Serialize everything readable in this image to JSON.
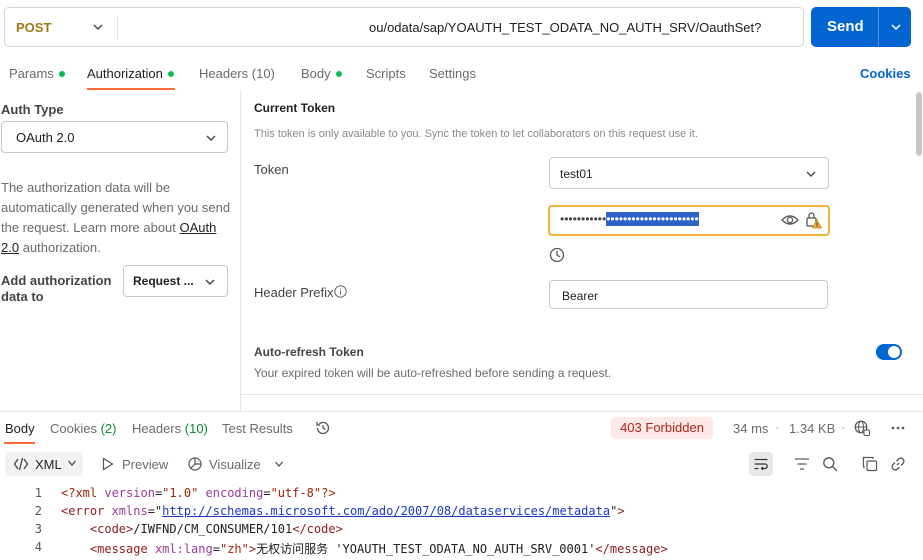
{
  "request": {
    "method": "POST",
    "url": "ou/odata/sap/YOAUTH_TEST_ODATA_NO_AUTH_SRV/OauthSet?",
    "send_label": "Send"
  },
  "tabs": [
    {
      "label": "Params",
      "dot": true
    },
    {
      "label": "Authorization",
      "dot": true
    },
    {
      "label": "Headers",
      "count": "(10)"
    },
    {
      "label": "Body",
      "dot": true
    },
    {
      "label": "Scripts"
    },
    {
      "label": "Settings"
    }
  ],
  "cookies_label": "Cookies",
  "auth": {
    "type_label": "Auth Type",
    "type_value": "OAuth 2.0",
    "desc_prefix": "The authorization data will be automatically generated when you send the request. Learn more about ",
    "desc_link": "OAuth 2.0",
    "desc_suffix": " authorization.",
    "add_to_label": "Add authorization data to",
    "add_to_value": "Request ..."
  },
  "current_token": {
    "title": "Current Token",
    "description": "This token is only available to you. Sync the token to let collaborators on this request use it.",
    "token_label": "Token",
    "token_select": "test01",
    "token_masked_plain": "•••••••••••",
    "token_masked_selected": "••••••••••••••••••••••",
    "header_prefix_label": "Header Prefix",
    "header_prefix_value": "Bearer",
    "autorefresh_label": "Auto-refresh Token",
    "autorefresh_desc": "Your expired token will be auto-refreshed before sending a request.",
    "autorefresh_on": true
  },
  "response": {
    "tabs": [
      {
        "label": "Body"
      },
      {
        "label": "Cookies",
        "count": "(2)"
      },
      {
        "label": "Headers",
        "count": "(10)"
      },
      {
        "label": "Test Results"
      }
    ],
    "status": "403 Forbidden",
    "time": "34 ms",
    "size": "1.34 KB",
    "format": "XML",
    "preview_label": "Preview",
    "visualize_label": "Visualize",
    "lines": [
      {
        "n": "1",
        "parts": [
          [
            "pi",
            "<?xml "
          ],
          [
            "attr",
            "version"
          ],
          [
            "txt",
            "="
          ],
          [
            "val",
            "\"1.0\""
          ],
          [
            "txt",
            " "
          ],
          [
            "attr",
            "encoding"
          ],
          [
            "txt",
            "="
          ],
          [
            "val",
            "\"utf-8\""
          ],
          [
            "pi",
            "?>"
          ]
        ]
      },
      {
        "n": "2",
        "parts": [
          [
            "tag",
            "<error "
          ],
          [
            "attr",
            "xmlns"
          ],
          [
            "txt",
            "=\""
          ],
          [
            "url",
            "http://schemas.microsoft.com/ado/2007/08/dataservices/metadata"
          ],
          [
            "txt",
            "\""
          ],
          [
            "tag",
            ">"
          ]
        ]
      },
      {
        "n": "3",
        "parts": [
          [
            "txt",
            "    "
          ],
          [
            "tag",
            "<code>"
          ],
          [
            "txt",
            "/IWFND/CM_CONSUMER/101"
          ],
          [
            "tag",
            "</code>"
          ]
        ]
      },
      {
        "n": "4",
        "parts": [
          [
            "txt",
            "    "
          ],
          [
            "tag",
            "<message "
          ],
          [
            "attr",
            "xml:lang"
          ],
          [
            "txt",
            "="
          ],
          [
            "val",
            "\"zh\""
          ],
          [
            "tag",
            ">"
          ],
          [
            "txt",
            "无权访问服务 'YOAUTH_TEST_ODATA_NO_AUTH_SRV_0001'"
          ],
          [
            "tag",
            "</message>"
          ]
        ]
      }
    ]
  }
}
